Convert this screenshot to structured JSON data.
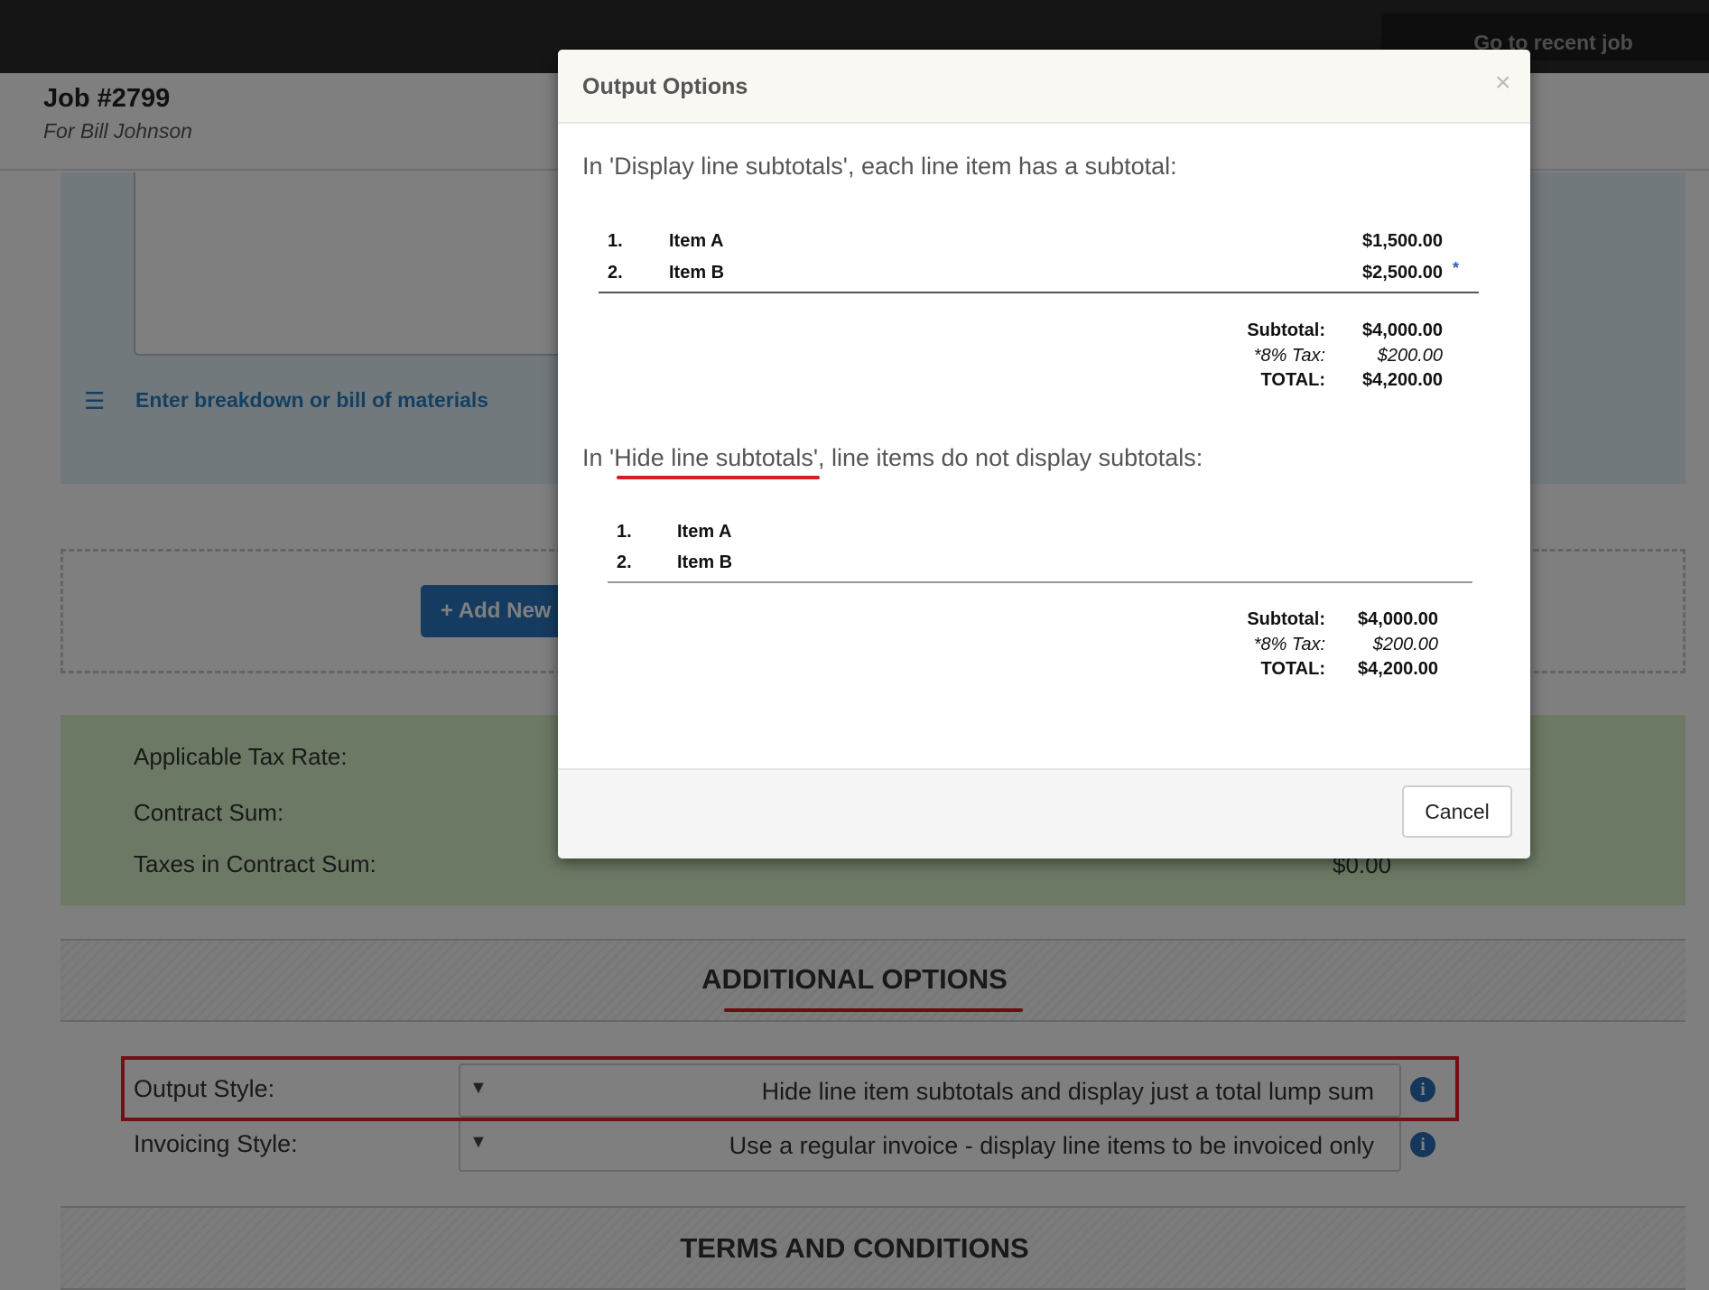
{
  "topbar": {
    "recent_job": "Go to recent job"
  },
  "job": {
    "title": "Job #2799",
    "subtitle": "For Bill Johnson"
  },
  "breakdown_link": "Enter breakdown or bill of materials",
  "add_new_button": "+ Add New",
  "tax_panel": {
    "applicable_tax_rate": "Applicable Tax Rate:",
    "contract_sum": "Contract Sum:",
    "taxes_in_contract_sum": "Taxes in Contract Sum:",
    "taxes_value": "$0.00"
  },
  "additional_options": {
    "heading": "ADDITIONAL OPTIONS",
    "output_style_label": "Output Style:",
    "output_style_value": "Hide line item subtotals and display just a total lump sum",
    "invoicing_style_label": "Invoicing Style:",
    "invoicing_style_value": "Use a regular invoice - display line items to be invoiced only"
  },
  "terms_heading": "TERMS AND CONDITIONS",
  "modal": {
    "title": "Output Options",
    "close": "×",
    "display_intro": "In 'Display line subtotals', each line item has a subtotal:",
    "hide_intro_prefix": "In '",
    "hide_intro_highlight": "Hide line subtotals",
    "hide_intro_suffix": "', line items do not display subtotals:",
    "example1": {
      "items": [
        {
          "num": "1.",
          "name": "Item A",
          "amount": "$1,500.00"
        },
        {
          "num": "2.",
          "name": "Item B",
          "amount": "$2,500.00"
        }
      ],
      "taxed_marker": "*",
      "subtotal_label": "Subtotal:",
      "subtotal": "$4,000.00",
      "tax_label": "*8% Tax:",
      "tax": "$200.00",
      "total_label": "TOTAL:",
      "total": "$4,200.00"
    },
    "example2": {
      "items": [
        {
          "num": "1.",
          "name": "Item A"
        },
        {
          "num": "2.",
          "name": "Item B"
        }
      ],
      "subtotal_label": "Subtotal:",
      "subtotal": "$4,000.00",
      "tax_label": "*8% Tax:",
      "tax": "$200.00",
      "total_label": "TOTAL:",
      "total": "$4,200.00"
    },
    "cancel": "Cancel"
  },
  "colors": {
    "accent_blue": "#2a77c0",
    "annotation_red": "#e3222b",
    "tax_panel_green": "#d9f3c8"
  },
  "icons": {
    "list": "list-icon",
    "info": "info-icon",
    "dropdown": "dropdown-arrow-icon",
    "close": "close-icon"
  }
}
